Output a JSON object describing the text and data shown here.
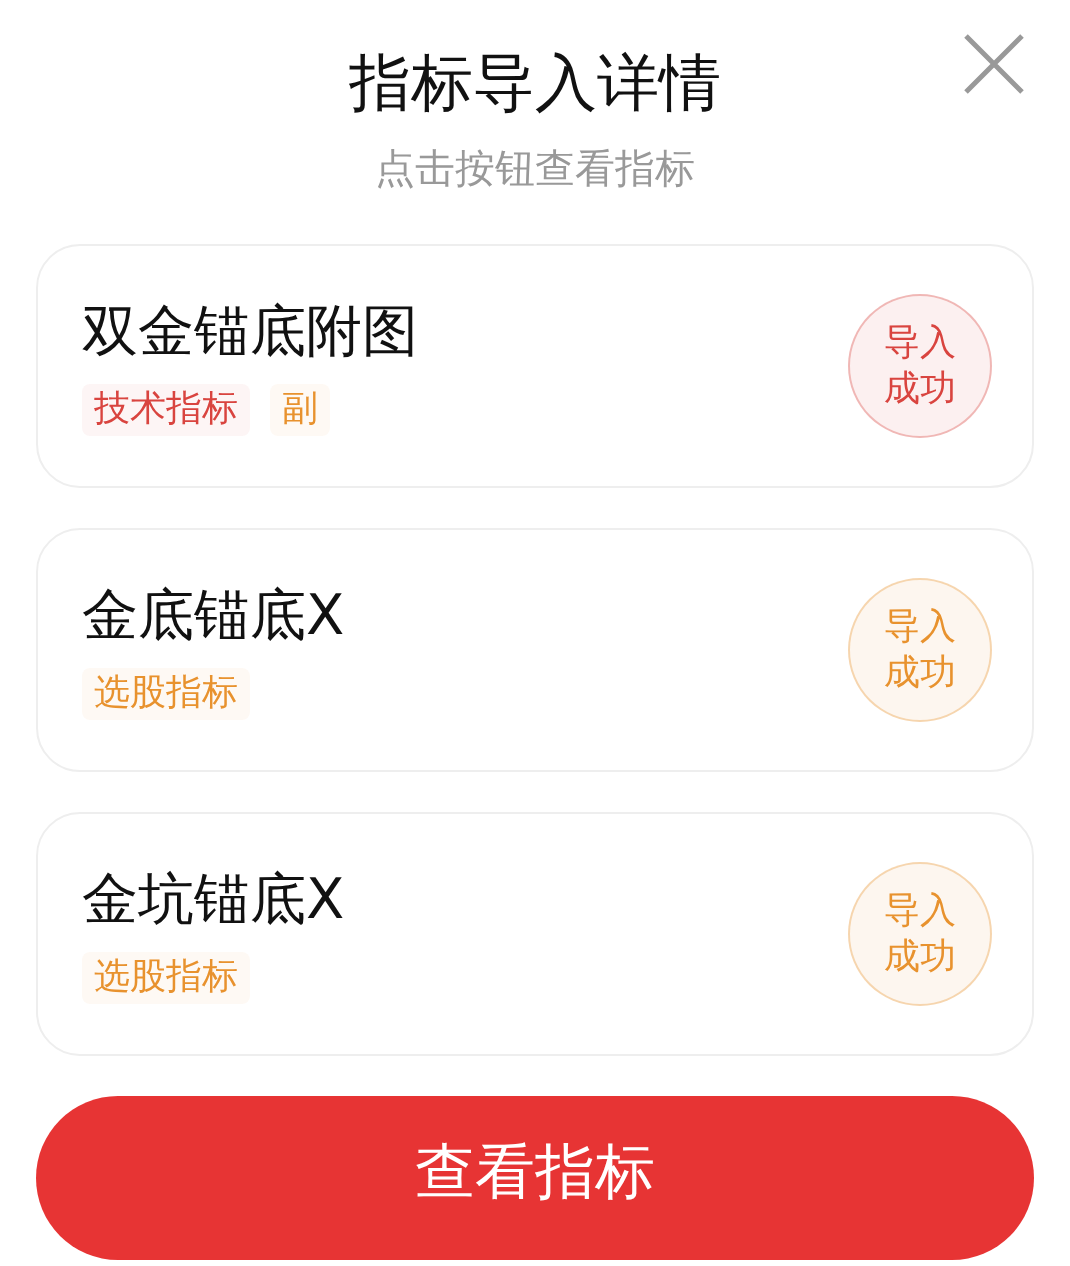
{
  "title": "指标导入详情",
  "subtitle": "点击按钮查看指标",
  "items": [
    {
      "name": "双金锚底附图",
      "tags": [
        {
          "label": "技术指标",
          "color": "#d9443f"
        },
        {
          "label": "副",
          "color": "#e8922e"
        }
      ],
      "status": {
        "label": "导入成功",
        "color": "#d9443f"
      }
    },
    {
      "name": "金底锚底X",
      "tags": [
        {
          "label": "选股指标",
          "color": "#e8922e"
        }
      ],
      "status": {
        "label": "导入成功",
        "color": "#e8922e"
      }
    },
    {
      "name": "金坑锚底X",
      "tags": [
        {
          "label": "选股指标",
          "color": "#e8922e"
        }
      ],
      "status": {
        "label": "导入成功",
        "color": "#e8922e"
      }
    }
  ],
  "button": "查看指标"
}
